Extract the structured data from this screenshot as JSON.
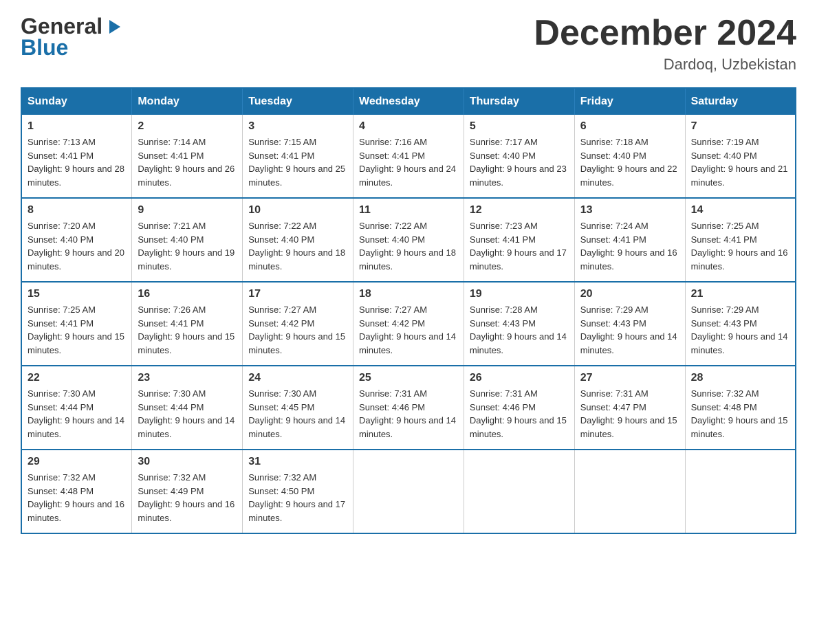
{
  "header": {
    "title": "December 2024",
    "subtitle": "Dardoq, Uzbekistan",
    "logo_general": "General",
    "logo_blue": "Blue"
  },
  "days_of_week": [
    "Sunday",
    "Monday",
    "Tuesday",
    "Wednesday",
    "Thursday",
    "Friday",
    "Saturday"
  ],
  "weeks": [
    [
      {
        "day": "1",
        "sunrise": "Sunrise: 7:13 AM",
        "sunset": "Sunset: 4:41 PM",
        "daylight": "Daylight: 9 hours and 28 minutes."
      },
      {
        "day": "2",
        "sunrise": "Sunrise: 7:14 AM",
        "sunset": "Sunset: 4:41 PM",
        "daylight": "Daylight: 9 hours and 26 minutes."
      },
      {
        "day": "3",
        "sunrise": "Sunrise: 7:15 AM",
        "sunset": "Sunset: 4:41 PM",
        "daylight": "Daylight: 9 hours and 25 minutes."
      },
      {
        "day": "4",
        "sunrise": "Sunrise: 7:16 AM",
        "sunset": "Sunset: 4:41 PM",
        "daylight": "Daylight: 9 hours and 24 minutes."
      },
      {
        "day": "5",
        "sunrise": "Sunrise: 7:17 AM",
        "sunset": "Sunset: 4:40 PM",
        "daylight": "Daylight: 9 hours and 23 minutes."
      },
      {
        "day": "6",
        "sunrise": "Sunrise: 7:18 AM",
        "sunset": "Sunset: 4:40 PM",
        "daylight": "Daylight: 9 hours and 22 minutes."
      },
      {
        "day": "7",
        "sunrise": "Sunrise: 7:19 AM",
        "sunset": "Sunset: 4:40 PM",
        "daylight": "Daylight: 9 hours and 21 minutes."
      }
    ],
    [
      {
        "day": "8",
        "sunrise": "Sunrise: 7:20 AM",
        "sunset": "Sunset: 4:40 PM",
        "daylight": "Daylight: 9 hours and 20 minutes."
      },
      {
        "day": "9",
        "sunrise": "Sunrise: 7:21 AM",
        "sunset": "Sunset: 4:40 PM",
        "daylight": "Daylight: 9 hours and 19 minutes."
      },
      {
        "day": "10",
        "sunrise": "Sunrise: 7:22 AM",
        "sunset": "Sunset: 4:40 PM",
        "daylight": "Daylight: 9 hours and 18 minutes."
      },
      {
        "day": "11",
        "sunrise": "Sunrise: 7:22 AM",
        "sunset": "Sunset: 4:40 PM",
        "daylight": "Daylight: 9 hours and 18 minutes."
      },
      {
        "day": "12",
        "sunrise": "Sunrise: 7:23 AM",
        "sunset": "Sunset: 4:41 PM",
        "daylight": "Daylight: 9 hours and 17 minutes."
      },
      {
        "day": "13",
        "sunrise": "Sunrise: 7:24 AM",
        "sunset": "Sunset: 4:41 PM",
        "daylight": "Daylight: 9 hours and 16 minutes."
      },
      {
        "day": "14",
        "sunrise": "Sunrise: 7:25 AM",
        "sunset": "Sunset: 4:41 PM",
        "daylight": "Daylight: 9 hours and 16 minutes."
      }
    ],
    [
      {
        "day": "15",
        "sunrise": "Sunrise: 7:25 AM",
        "sunset": "Sunset: 4:41 PM",
        "daylight": "Daylight: 9 hours and 15 minutes."
      },
      {
        "day": "16",
        "sunrise": "Sunrise: 7:26 AM",
        "sunset": "Sunset: 4:41 PM",
        "daylight": "Daylight: 9 hours and 15 minutes."
      },
      {
        "day": "17",
        "sunrise": "Sunrise: 7:27 AM",
        "sunset": "Sunset: 4:42 PM",
        "daylight": "Daylight: 9 hours and 15 minutes."
      },
      {
        "day": "18",
        "sunrise": "Sunrise: 7:27 AM",
        "sunset": "Sunset: 4:42 PM",
        "daylight": "Daylight: 9 hours and 14 minutes."
      },
      {
        "day": "19",
        "sunrise": "Sunrise: 7:28 AM",
        "sunset": "Sunset: 4:43 PM",
        "daylight": "Daylight: 9 hours and 14 minutes."
      },
      {
        "day": "20",
        "sunrise": "Sunrise: 7:29 AM",
        "sunset": "Sunset: 4:43 PM",
        "daylight": "Daylight: 9 hours and 14 minutes."
      },
      {
        "day": "21",
        "sunrise": "Sunrise: 7:29 AM",
        "sunset": "Sunset: 4:43 PM",
        "daylight": "Daylight: 9 hours and 14 minutes."
      }
    ],
    [
      {
        "day": "22",
        "sunrise": "Sunrise: 7:30 AM",
        "sunset": "Sunset: 4:44 PM",
        "daylight": "Daylight: 9 hours and 14 minutes."
      },
      {
        "day": "23",
        "sunrise": "Sunrise: 7:30 AM",
        "sunset": "Sunset: 4:44 PM",
        "daylight": "Daylight: 9 hours and 14 minutes."
      },
      {
        "day": "24",
        "sunrise": "Sunrise: 7:30 AM",
        "sunset": "Sunset: 4:45 PM",
        "daylight": "Daylight: 9 hours and 14 minutes."
      },
      {
        "day": "25",
        "sunrise": "Sunrise: 7:31 AM",
        "sunset": "Sunset: 4:46 PM",
        "daylight": "Daylight: 9 hours and 14 minutes."
      },
      {
        "day": "26",
        "sunrise": "Sunrise: 7:31 AM",
        "sunset": "Sunset: 4:46 PM",
        "daylight": "Daylight: 9 hours and 15 minutes."
      },
      {
        "day": "27",
        "sunrise": "Sunrise: 7:31 AM",
        "sunset": "Sunset: 4:47 PM",
        "daylight": "Daylight: 9 hours and 15 minutes."
      },
      {
        "day": "28",
        "sunrise": "Sunrise: 7:32 AM",
        "sunset": "Sunset: 4:48 PM",
        "daylight": "Daylight: 9 hours and 15 minutes."
      }
    ],
    [
      {
        "day": "29",
        "sunrise": "Sunrise: 7:32 AM",
        "sunset": "Sunset: 4:48 PM",
        "daylight": "Daylight: 9 hours and 16 minutes."
      },
      {
        "day": "30",
        "sunrise": "Sunrise: 7:32 AM",
        "sunset": "Sunset: 4:49 PM",
        "daylight": "Daylight: 9 hours and 16 minutes."
      },
      {
        "day": "31",
        "sunrise": "Sunrise: 7:32 AM",
        "sunset": "Sunset: 4:50 PM",
        "daylight": "Daylight: 9 hours and 17 minutes."
      },
      null,
      null,
      null,
      null
    ]
  ]
}
